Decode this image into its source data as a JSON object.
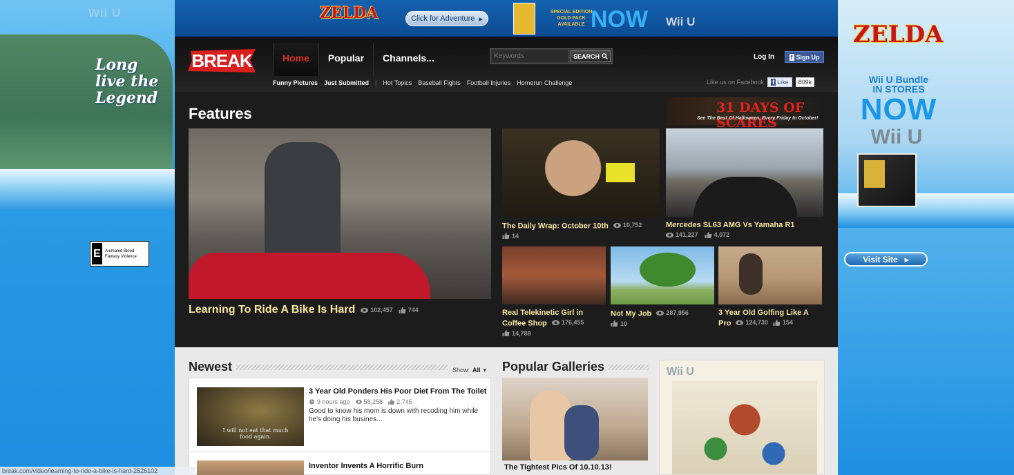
{
  "skin_left": {
    "brand": "Wii U",
    "tagline": "Long live the Legend",
    "rating_letter": "E",
    "rating_desc": "Animated Blood Fantasy Violence"
  },
  "skin_right": {
    "logo": "ZELDA",
    "bundle_line1": "Wii U Bundle",
    "bundle_line2": "IN STORES",
    "now": "NOW",
    "brand": "Wii U",
    "visit_label": "Visit Site"
  },
  "banner": {
    "logo": "ZELDA",
    "adventure_label": "Click for Adventure",
    "special_text": "SPECIAL EDITION GOLD PACK AVAILABLE",
    "now": "NOW",
    "platform": "Wii U"
  },
  "nav": {
    "logo": "BREAK",
    "tabs": [
      "Home",
      "Popular",
      "Channels..."
    ],
    "search_placeholder": "Keywords",
    "search_label": "SEARCH",
    "login": "Log In",
    "signup": "Sign Up",
    "subnav": [
      "Funny Pictures",
      "Just Submitted",
      "Hot Topics",
      "Baseball Fights",
      "Football Injuries",
      "Homerun Challenge"
    ],
    "fb_text": "Like us on Facebook",
    "fb_like": "Like",
    "fb_count": "809k"
  },
  "features": {
    "title": "Features",
    "promo_big": "31 DAYS OF SCARES",
    "promo_small": "See The Best Of Halloween, Every Friday In October!",
    "main": {
      "title": "Learning To Ride A Bike Is Hard",
      "views": "102,457",
      "likes": "744"
    },
    "items": [
      {
        "title": "The Daily Wrap: October 10th",
        "views": "10,752",
        "likes": "14"
      },
      {
        "title": "Mercedes SL63 AMG Vs Yamaha R1",
        "views": "141,227",
        "likes": "4,072"
      },
      {
        "title": "Real Telekinetic Girl in Coffee Shop",
        "views": "176,455",
        "likes": "14,788"
      },
      {
        "title": "Not My Job",
        "views": "287,956",
        "likes": "10"
      },
      {
        "title": "3 Year Old Golfing Like A Pro",
        "views": "124,730",
        "likes": "154"
      }
    ]
  },
  "newest": {
    "title": "Newest",
    "show_label": "Show:",
    "show_value": "All",
    "items": [
      {
        "title": "3 Year Old Ponders His Poor Diet From The Toilet",
        "time": "9 hours ago",
        "views": "58,258",
        "likes": "2,745",
        "desc": "Good to know his mom is down with recoding him while he's doing his busines...",
        "subtitle": "I will not eat that much food again."
      },
      {
        "title": "Inventor Invents A Horrific Burn"
      }
    ]
  },
  "galleries": {
    "title": "Popular Galleries",
    "item_title": "The Tightest Pics Of 10.10.13!"
  },
  "ad_box": {
    "brand": "Wii U"
  },
  "status_url": "break.com/video/learning-to-ride-a-bike-is-hard-2526102"
}
